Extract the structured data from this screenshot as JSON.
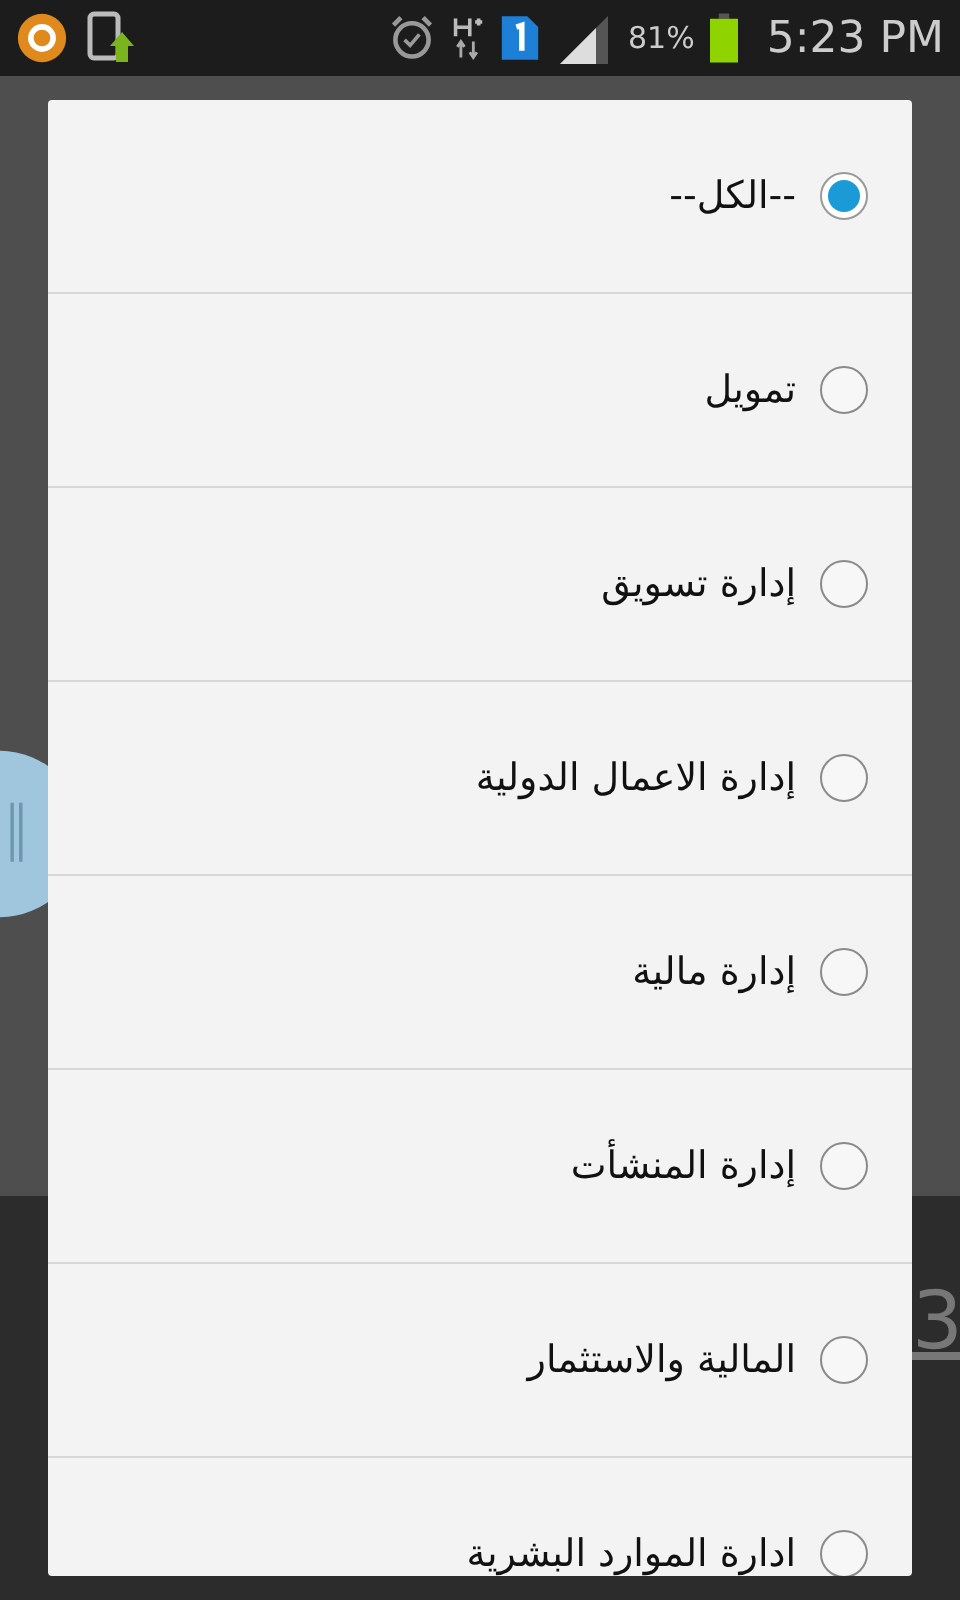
{
  "status_bar": {
    "battery": "81%",
    "time": "5:23 PM"
  },
  "background": {
    "digit": "3"
  },
  "dialog": {
    "options": [
      {
        "label": "--الكل--",
        "selected": true
      },
      {
        "label": "تمويل",
        "selected": false
      },
      {
        "label": "إدارة تسويق",
        "selected": false
      },
      {
        "label": "إدارة الاعمال الدولية",
        "selected": false
      },
      {
        "label": "إدارة مالية",
        "selected": false
      },
      {
        "label": "إدارة المنشأت",
        "selected": false
      },
      {
        "label": "المالية والاستثمار",
        "selected": false
      },
      {
        "label": "ادارة الموارد البشرية",
        "selected": false
      }
    ]
  }
}
